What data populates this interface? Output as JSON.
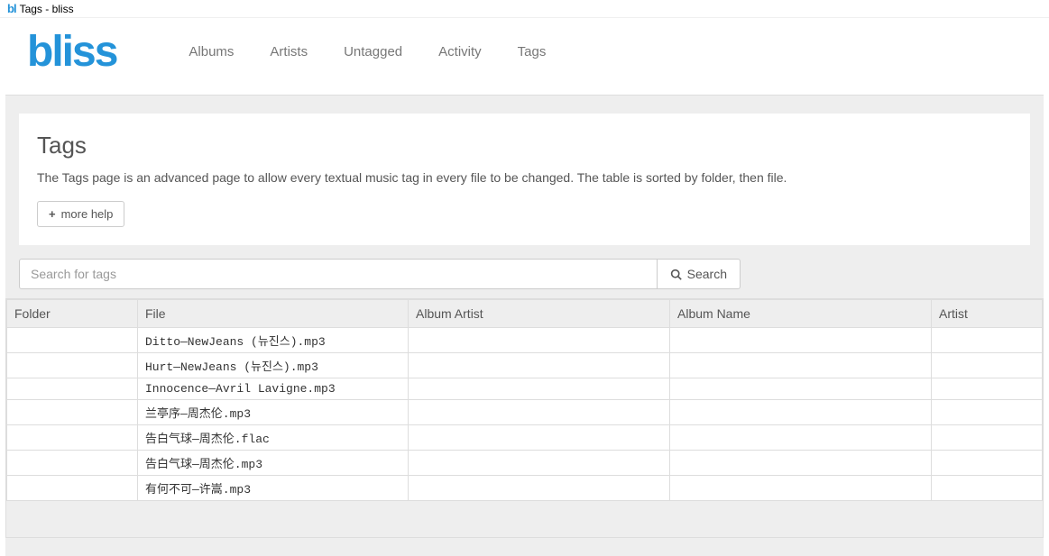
{
  "window": {
    "icon_text": "bl",
    "title": "Tags - bliss"
  },
  "header": {
    "logo": "bliss",
    "nav": [
      "Albums",
      "Artists",
      "Untagged",
      "Activity",
      "Tags"
    ]
  },
  "page": {
    "title": "Tags",
    "description": "The Tags page is an advanced page to allow every textual music tag in every file to be changed. The table is sorted by folder, then file.",
    "more_help_label": "more help"
  },
  "search": {
    "placeholder": "Search for tags",
    "button_label": "Search"
  },
  "table": {
    "headers": {
      "folder": "Folder",
      "file": "File",
      "album_artist": "Album Artist",
      "album_name": "Album Name",
      "artist": "Artist"
    },
    "rows": [
      {
        "folder": "",
        "file": "Ditto—NewJeans (뉴진스).mp3",
        "album_artist": "",
        "album_name": "",
        "artist": ""
      },
      {
        "folder": "",
        "file": "Hurt—NewJeans (뉴진스).mp3",
        "album_artist": "",
        "album_name": "",
        "artist": ""
      },
      {
        "folder": "",
        "file": "Innocence—Avril Lavigne.mp3",
        "album_artist": "",
        "album_name": "",
        "artist": ""
      },
      {
        "folder": "",
        "file": "兰亭序—周杰伦.mp3",
        "album_artist": "",
        "album_name": "",
        "artist": ""
      },
      {
        "folder": "",
        "file": "告白气球—周杰伦.flac",
        "album_artist": "",
        "album_name": "",
        "artist": ""
      },
      {
        "folder": "",
        "file": "告白气球—周杰伦.mp3",
        "album_artist": "",
        "album_name": "",
        "artist": ""
      },
      {
        "folder": "",
        "file": "有何不可—许嵩.mp3",
        "album_artist": "",
        "album_name": "",
        "artist": ""
      }
    ]
  }
}
